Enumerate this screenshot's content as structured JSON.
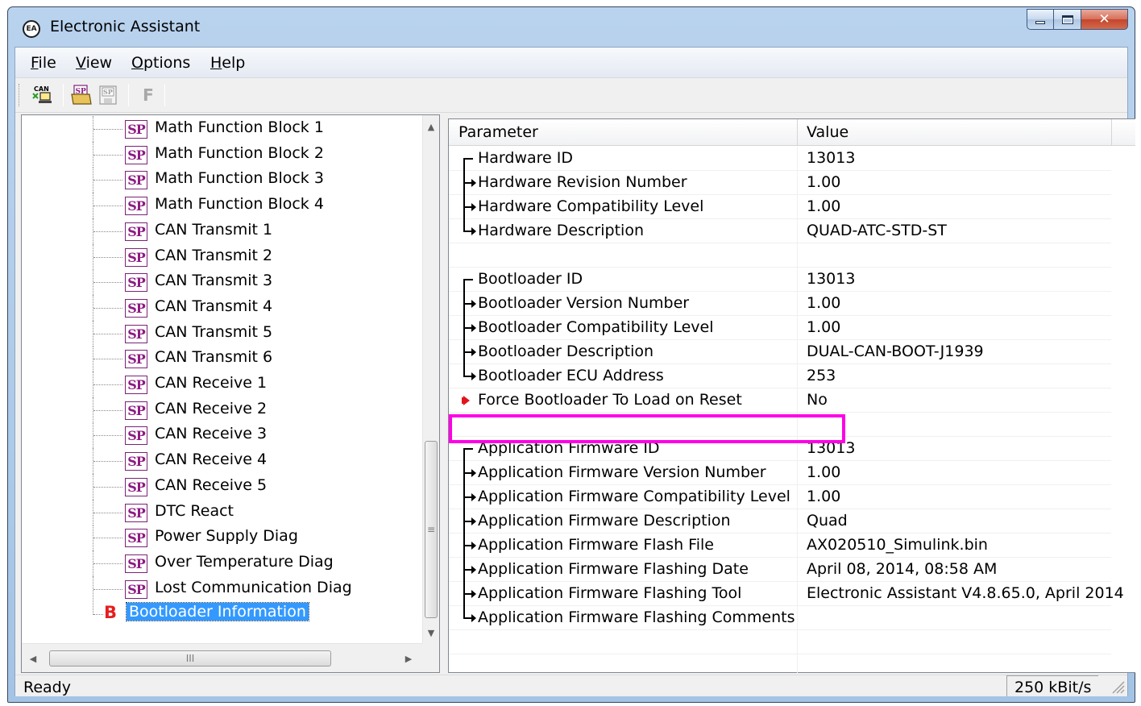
{
  "window": {
    "title": "Electronic Assistant",
    "icon_text": "EA"
  },
  "menu": [
    {
      "label": "File",
      "hotkey": "F",
      "rest": "ile"
    },
    {
      "label": "View",
      "hotkey": "V",
      "rest": "iew"
    },
    {
      "label": "Options",
      "hotkey": "O",
      "rest": "ptions"
    },
    {
      "label": "Help",
      "hotkey": "H",
      "rest": "elp"
    }
  ],
  "toolbar": {
    "can_icon_text": "CAN",
    "sp_open_text": "SP",
    "sp_save_text": "SP",
    "f_button_text": "F"
  },
  "tree": {
    "sp_icon_text": "SP",
    "items": [
      "Math Function Block 1",
      "Math Function Block 2",
      "Math Function Block 3",
      "Math Function Block 4",
      "CAN Transmit 1",
      "CAN Transmit 2",
      "CAN Transmit 3",
      "CAN Transmit 4",
      "CAN Transmit 5",
      "CAN Transmit 6",
      "CAN Receive 1",
      "CAN Receive 2",
      "CAN Receive 3",
      "CAN Receive 4",
      "CAN Receive 5",
      "DTC React",
      "Power Supply Diag",
      "Over Temperature Diag",
      "Lost Communication Diag"
    ],
    "selected": {
      "icon_text": "B",
      "label": "Bootloader Information"
    },
    "hscroll_thumb_text": "III",
    "vscroll_thumb_text": "≡"
  },
  "table": {
    "columns": [
      "Parameter",
      "Value"
    ],
    "groups": [
      [
        {
          "name": "Hardware ID",
          "value": "13013"
        },
        {
          "name": "Hardware Revision Number",
          "value": "1.00"
        },
        {
          "name": "Hardware Compatibility Level",
          "value": "1.00"
        },
        {
          "name": "Hardware Description",
          "value": "QUAD-ATC-STD-ST"
        }
      ],
      [
        {
          "name": "Bootloader ID",
          "value": "13013"
        },
        {
          "name": "Bootloader Version Number",
          "value": "1.00"
        },
        {
          "name": "Bootloader Compatibility Level",
          "value": "1.00"
        },
        {
          "name": "Bootloader Description",
          "value": "DUAL-CAN-BOOT-J1939"
        },
        {
          "name": "Bootloader ECU Address",
          "value": "253"
        }
      ],
      [
        {
          "name": "Application Firmware ID",
          "value": "13013"
        },
        {
          "name": "Application Firmware Version Number",
          "value": "1.00"
        },
        {
          "name": "Application Firmware Compatibility Level",
          "value": "1.00"
        },
        {
          "name": "Application Firmware Description",
          "value": "Quad"
        },
        {
          "name": "Application Firmware Flash File",
          "value": "AX020510_Simulink.bin"
        },
        {
          "name": "Application Firmware Flashing Date",
          "value": "April 08, 2014, 08:58 AM"
        },
        {
          "name": "Application Firmware Flashing Tool",
          "value": "Electronic Assistant V4.8.65.0, April 2014"
        },
        {
          "name": "Application Firmware Flashing Comments",
          "value": ""
        }
      ]
    ],
    "editable": {
      "name": "Force Bootloader To Load on Reset",
      "value": "No"
    },
    "highlight_color": "#ff00e6"
  },
  "status": {
    "text": "Ready",
    "baud": "250 kBit/s"
  }
}
